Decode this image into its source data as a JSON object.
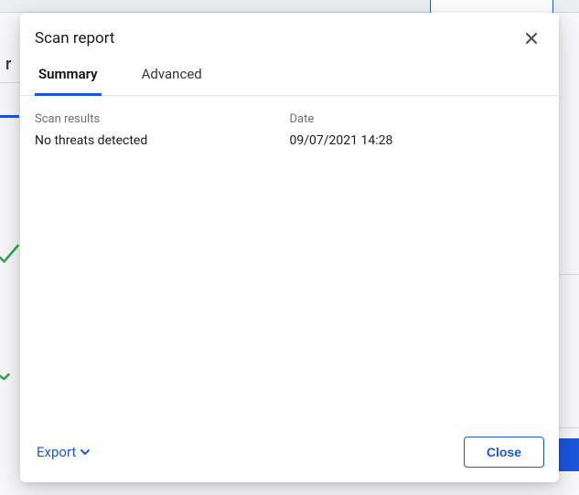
{
  "modal": {
    "title": "Scan report",
    "tabs": {
      "summary": "Summary",
      "advanced": "Advanced"
    },
    "columns": {
      "scan_results_label": "Scan results",
      "scan_results_value": "No threats detected",
      "date_label": "Date",
      "date_value": "09/07/2021 14:28"
    },
    "footer": {
      "export_label": "Export",
      "close_label": "Close"
    }
  },
  "background": {
    "left_truncated_text": "r"
  }
}
